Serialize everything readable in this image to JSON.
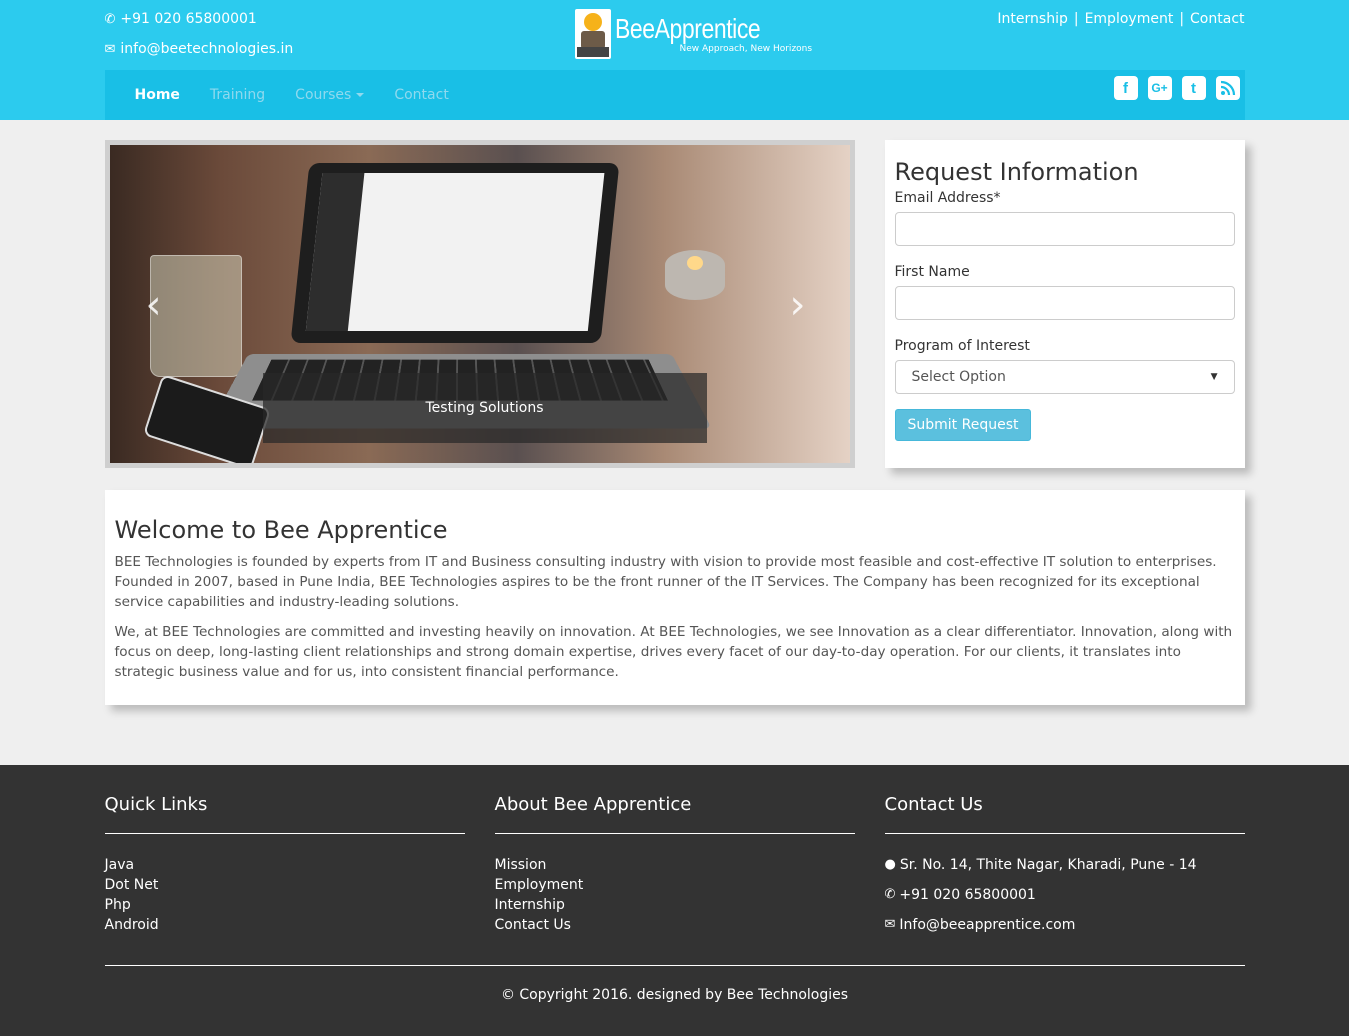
{
  "header": {
    "phone": "+91 020 65800001",
    "email": "info@beetechnologies.in",
    "logo_name": "BeeApprentice",
    "logo_tagline": "New Approach, New Horizons",
    "top_links": [
      "Internship",
      "Employment",
      "Contact"
    ],
    "separator": "|"
  },
  "nav": {
    "items": [
      {
        "label": "Home",
        "active": true
      },
      {
        "label": "Training"
      },
      {
        "label": "Courses",
        "dropdown": true
      },
      {
        "label": "Contact"
      }
    ],
    "socials": [
      "facebook-icon",
      "google-plus-icon",
      "twitter-icon",
      "rss-icon"
    ]
  },
  "slider": {
    "caption": "Testing Solutions",
    "prev": "‹",
    "next": "›"
  },
  "form": {
    "title": "Request Information",
    "email_label": "Email Address*",
    "first_name_label": "First Name",
    "program_label": "Program of Interest",
    "program_selected": "Select Option",
    "submit_label": "Submit Request"
  },
  "welcome": {
    "title": "Welcome to Bee Apprentice",
    "p1": "BEE Technologies is founded by experts from IT and Business consulting industry with vision to provide most feasible and cost-effective IT solution to enterprises. Founded in 2007, based in Pune India, BEE Technologies aspires to be the front runner of the IT Services. The Company has been recognized for its exceptional service capabilities and industry-leading solutions.",
    "p2": "We, at BEE Technologies are committed and investing heavily on innovation. At BEE Technologies, we see Innovation as a clear differentiator. Innovation, along with focus on deep, long-lasting client relationships and strong domain expertise, drives every facet of our day-to-day operation. For our clients, it translates into strategic business value and for us, into consistent financial performance."
  },
  "footer": {
    "quick_links_title": "Quick Links",
    "quick_links": [
      "Java",
      "Dot Net",
      "Php",
      "Android"
    ],
    "about_title": "About Bee Apprentice",
    "about_links": [
      "Mission",
      "Employment",
      "Internship",
      "Contact Us"
    ],
    "contact_title": "Contact Us",
    "address": "Sr. No. 14, Thite Nagar, Kharadi, Pune - 14",
    "phone": "+91 020 65800001",
    "email": "Info@beeapprentice.com",
    "copyright": "© Copyright 2016. designed by Bee Technologies"
  },
  "colors": {
    "header_bg": "#2ccbee",
    "nav_bg": "#19bfe6",
    "footer_bg": "#333333",
    "button": "#5bc0de"
  }
}
